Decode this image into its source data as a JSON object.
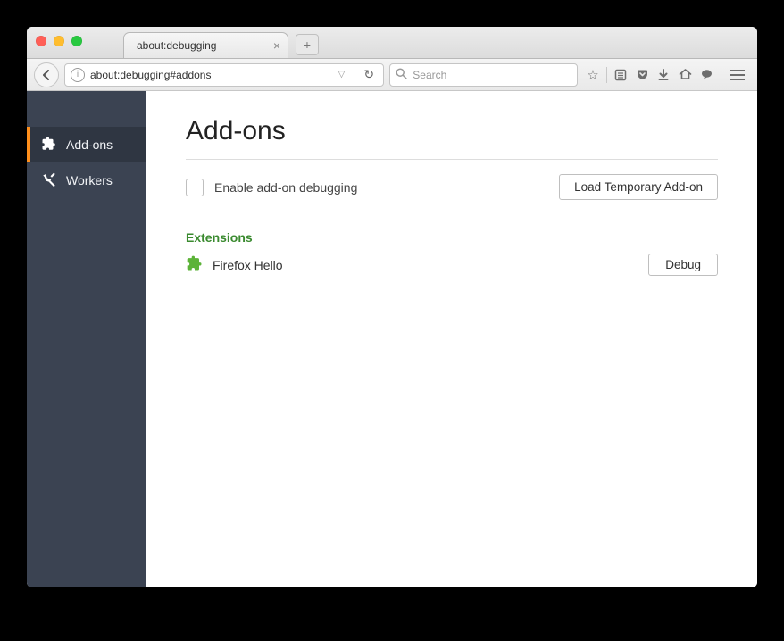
{
  "traffic_colors": {
    "close": "#ff5f57",
    "min": "#ffbd2e",
    "max": "#28c940"
  },
  "tab": {
    "title": "about:debugging"
  },
  "urlbar": {
    "value": "about:debugging#addons"
  },
  "searchbar": {
    "placeholder": "Search"
  },
  "sidebar": {
    "items": [
      {
        "label": "Add-ons",
        "active": true
      },
      {
        "label": "Workers",
        "active": false
      }
    ]
  },
  "main": {
    "heading": "Add-ons",
    "enable_debug_label": "Enable add-on debugging",
    "load_temp_btn": "Load Temporary Add-on",
    "section_extensions": "Extensions",
    "extensions": [
      {
        "name": "Firefox Hello",
        "debug_btn": "Debug"
      }
    ]
  }
}
